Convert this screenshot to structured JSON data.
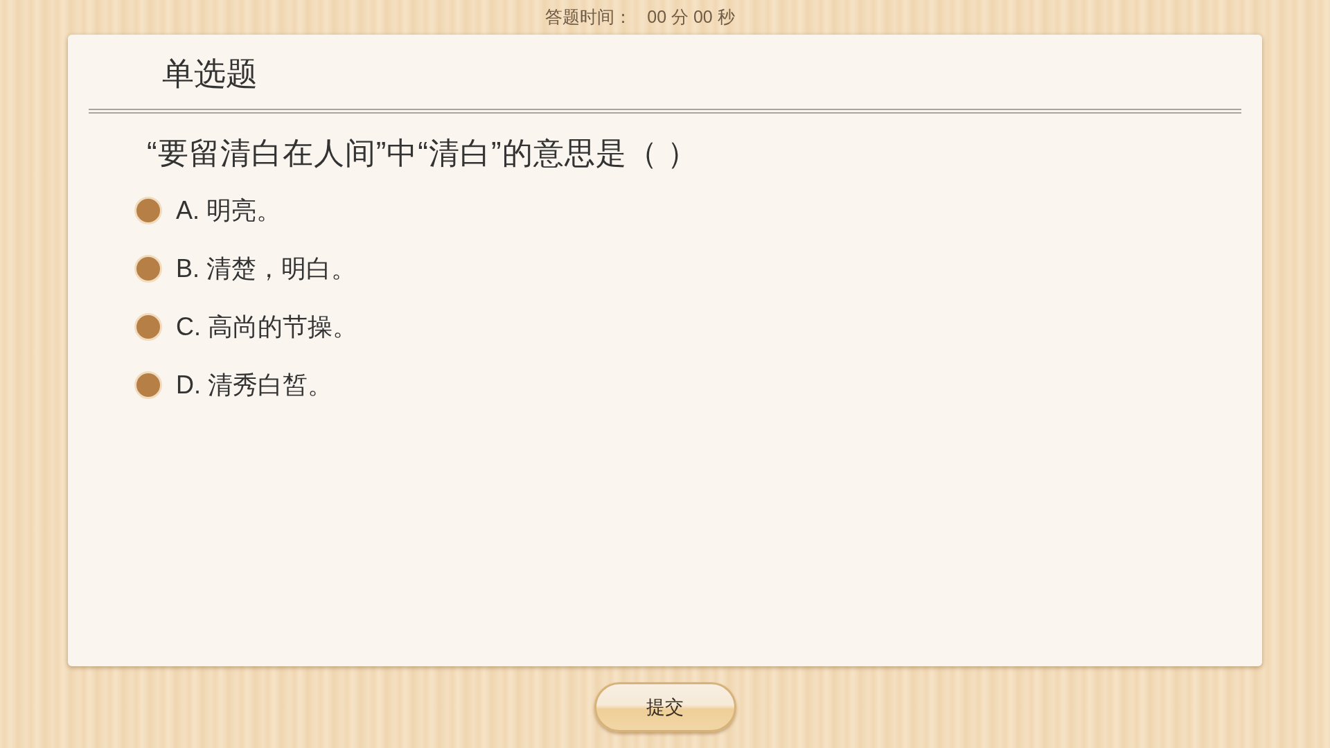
{
  "timer": {
    "label": "答题时间：",
    "value": "00 分 00 秒"
  },
  "card": {
    "title": "单选题",
    "question": "“要留清白在人间”中“清白”的意思是（  ）",
    "options": [
      {
        "text": "A. 明亮。",
        "selected": false
      },
      {
        "text": "B. 清楚，明白。",
        "selected": false
      },
      {
        "text": "C. 高尚的节操。",
        "selected": false
      },
      {
        "text": "D. 清秀白皙。",
        "selected": false
      }
    ]
  },
  "submit_button": {
    "label": "提交"
  }
}
